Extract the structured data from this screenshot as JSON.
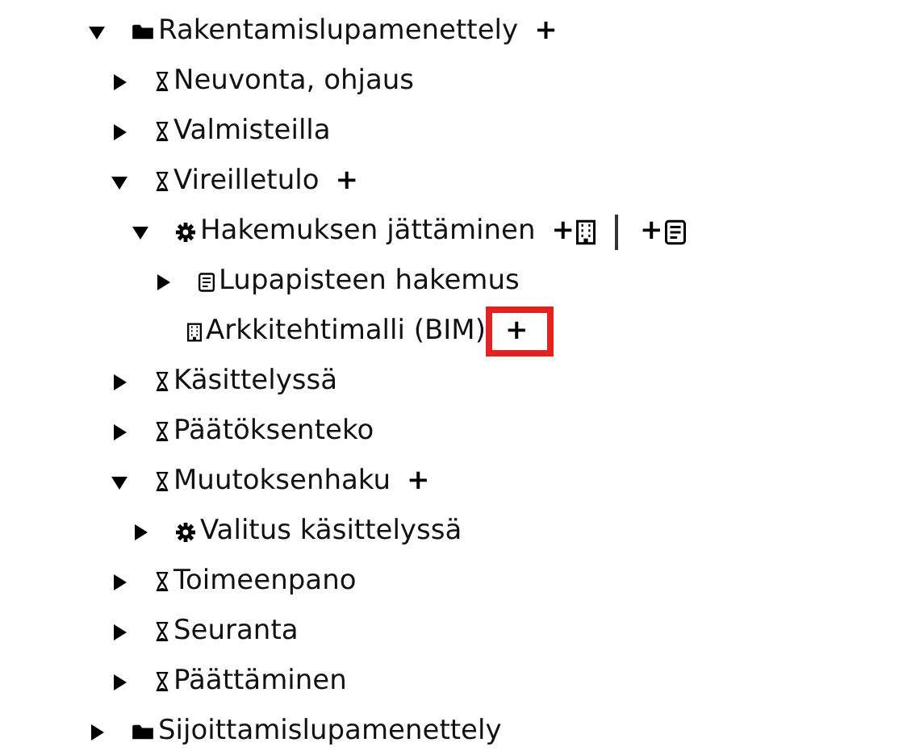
{
  "tree": [
    {
      "label": "Rakentamislupamenettely",
      "kind": "folder",
      "expanded": true,
      "actions": [
        {
          "label": "+",
          "highlighted": false
        }
      ],
      "children": [
        {
          "label": "Neuvonta, ohjaus",
          "kind": "phase",
          "expanded": false
        },
        {
          "label": "Valmisteilla",
          "kind": "phase",
          "expanded": false
        },
        {
          "label": "Vireilletulo",
          "kind": "phase",
          "expanded": true,
          "actions": [
            {
              "label": "+",
              "highlighted": false
            }
          ],
          "children": [
            {
              "label": "Hakemuksen jättäminen",
              "kind": "task",
              "expanded": true,
              "actions": [
                {
                  "label": "+",
                  "kind": "building",
                  "highlighted": false
                },
                {
                  "label": "+",
                  "kind": "document",
                  "highlighted": false
                }
              ],
              "children": [
                {
                  "label": "Lupapisteen hakemus",
                  "kind": "document",
                  "expanded": false
                },
                {
                  "label": "Arkkitehtimalli (BIM)",
                  "kind": "building",
                  "actions": [
                    {
                      "label": "+",
                      "highlighted": true
                    }
                  ]
                }
              ]
            }
          ]
        },
        {
          "label": "Käsittelyssä",
          "kind": "phase",
          "expanded": false
        },
        {
          "label": "Päätöksenteko",
          "kind": "phase",
          "expanded": false
        },
        {
          "label": "Muutoksenhaku",
          "kind": "phase",
          "expanded": true,
          "actions": [
            {
              "label": "+",
              "highlighted": false
            }
          ],
          "children": [
            {
              "label": "Valitus käsittelyssä",
              "kind": "task",
              "expanded": false
            }
          ]
        },
        {
          "label": "Toimeenpano",
          "kind": "phase",
          "expanded": false
        },
        {
          "label": "Seuranta",
          "kind": "phase",
          "expanded": false
        },
        {
          "label": "Päättäminen",
          "kind": "phase",
          "expanded": false
        }
      ]
    },
    {
      "label": "Sijoittamislupamenettely",
      "kind": "folder",
      "expanded": false
    }
  ]
}
